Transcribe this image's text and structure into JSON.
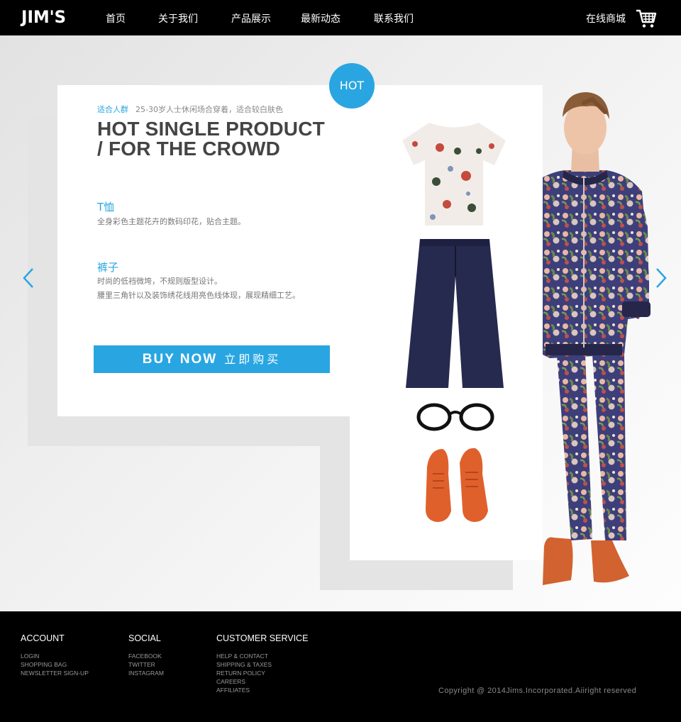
{
  "header": {
    "logo": "JIM'S",
    "nav": [
      {
        "label": "首页"
      },
      {
        "label": "关于我们"
      },
      {
        "label": "产品展示"
      },
      {
        "label": "最新动态"
      },
      {
        "label": "联系我们"
      }
    ],
    "shop_label": "在线商城",
    "cart_icon": "shopping-cart-icon"
  },
  "hero": {
    "badge": "HOT",
    "crowd_tag": "适合人群",
    "crowd_text": "25-30岁人士休闲场合穿着，适合较白肤色",
    "headline_line1": "HOT SINGLE PRODUCT",
    "headline_line2": "/ FOR THE CROWD",
    "items": [
      {
        "title": "T恤",
        "desc": [
          "全身彩色主题花卉的数码印花，贴合主题。"
        ]
      },
      {
        "title": "裤子",
        "desc": [
          "时尚的低裆微垮，不规则版型设计。",
          "腰里三角针以及装饰绣花线用亮色线体现，展现精细工艺。"
        ]
      }
    ],
    "buy_en": "BUY NOW",
    "buy_cn": "立即购买",
    "prev_icon": "chevron-left-icon",
    "next_icon": "chevron-right-icon",
    "accent": "#29a6e1"
  },
  "footer": {
    "columns": [
      {
        "title": "ACCOUNT",
        "links": [
          "LOGIN",
          "SHOPPING BAG",
          "NEWSLETTER SIGN-UP"
        ]
      },
      {
        "title": "SOCIAL",
        "links": [
          "FACEBOOK",
          "TWITTER",
          "INSTAGRAM"
        ]
      },
      {
        "title": "CUSTOMER SERVICE",
        "links": [
          "HELP & CONTACT",
          "SHIPPING & TAXES",
          "RETURN POLICY",
          "CAREERS",
          "AFFILIATES"
        ]
      }
    ],
    "copyright": "Copyright @ 2014Jims.Incorporated.Aiiright reserved"
  }
}
